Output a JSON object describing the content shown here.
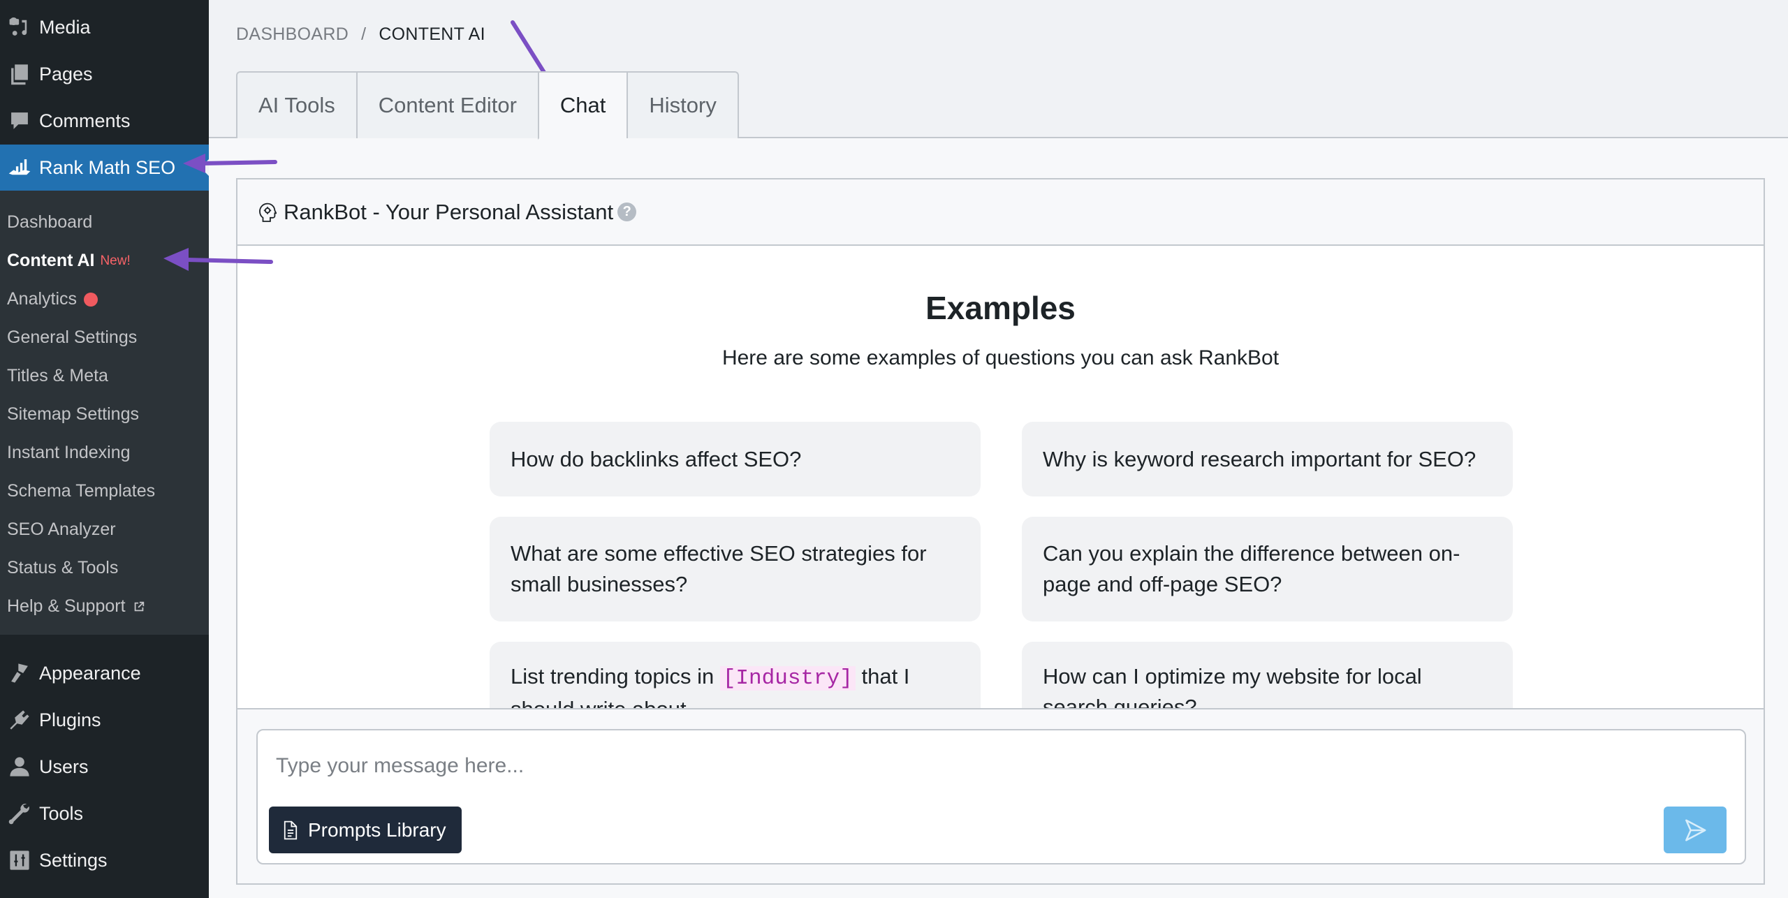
{
  "sidebar": {
    "top_items": [
      {
        "label": "Media",
        "icon": "media-icon"
      },
      {
        "label": "Pages",
        "icon": "pages-icon"
      },
      {
        "label": "Comments",
        "icon": "comments-icon"
      },
      {
        "label": "Rank Math SEO",
        "icon": "rank-math-icon",
        "active": true
      }
    ],
    "submenu": [
      {
        "label": "Dashboard"
      },
      {
        "label": "Content AI",
        "badge": "New!",
        "current": true
      },
      {
        "label": "Analytics",
        "indicator": "red-dot"
      },
      {
        "label": "General Settings"
      },
      {
        "label": "Titles & Meta"
      },
      {
        "label": "Sitemap Settings"
      },
      {
        "label": "Instant Indexing"
      },
      {
        "label": "Schema Templates"
      },
      {
        "label": "SEO Analyzer"
      },
      {
        "label": "Status & Tools"
      },
      {
        "label": "Help & Support",
        "icon": "external-link-icon"
      }
    ],
    "bottom_items": [
      {
        "label": "Appearance",
        "icon": "appearance-icon"
      },
      {
        "label": "Plugins",
        "icon": "plugins-icon"
      },
      {
        "label": "Users",
        "icon": "users-icon"
      },
      {
        "label": "Tools",
        "icon": "tools-icon"
      },
      {
        "label": "Settings",
        "icon": "settings-icon"
      }
    ]
  },
  "breadcrumb": {
    "parent": "DASHBOARD",
    "separator": "/",
    "current": "CONTENT AI"
  },
  "tabs": [
    {
      "label": "AI Tools"
    },
    {
      "label": "Content Editor"
    },
    {
      "label": "Chat",
      "active": true
    },
    {
      "label": "History"
    }
  ],
  "panel": {
    "title": "RankBot - Your Personal Assistant",
    "help_icon": "?",
    "examples_title": "Examples",
    "examples_subtitle": "Here are some examples of questions you can ask RankBot",
    "examples": [
      {
        "text": "How do backlinks affect SEO?"
      },
      {
        "text": "Why is keyword research important for SEO?"
      },
      {
        "text": "What are some effective SEO strategies for small businesses?"
      },
      {
        "text": "Can you explain the difference between on-page and off-page SEO?"
      },
      {
        "text_before": "List trending topics in ",
        "token": "[Industry]",
        "text_after": " that I should write about"
      },
      {
        "text": "How can I optimize my website for local search queries?"
      }
    ],
    "input": {
      "value": "",
      "placeholder": "Type your message here..."
    },
    "prompts_button": "Prompts Library",
    "send_button_icon": "send-icon"
  },
  "colors": {
    "sidebar_bg": "#1d2327",
    "submenu_bg": "#2c3338",
    "active_menu": "#2271b1",
    "badge_new": "#f86368",
    "prompts_button_bg": "#1f2a3a",
    "send_button_bg": "#6bb9ea",
    "token": "#a626a4",
    "annotation_arrow": "#7b4fc4"
  }
}
